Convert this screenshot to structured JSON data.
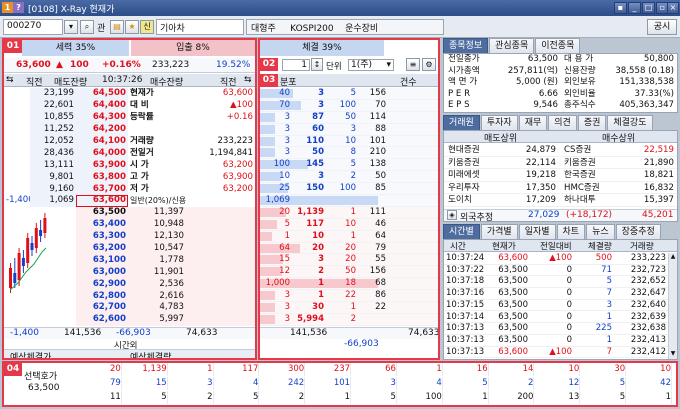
{
  "window": {
    "code": "0108",
    "title": "X-Ray 현재가"
  },
  "toolbar": {
    "stock_code": "000270",
    "search_label": "관",
    "favorite_icon": "star",
    "stock_badge": "신",
    "stock_name": "기아차",
    "tag1": "대형주",
    "tag2": "KOSPI200",
    "tag3": "운수장비",
    "public_button": "공시"
  },
  "section_badges": [
    "01",
    "02",
    "03",
    "04"
  ],
  "ratio": {
    "sell": "세력 35%",
    "buy": "입출 8%",
    "strength": "체결 39%"
  },
  "price_summary": {
    "price": "63,600",
    "diff": "100",
    "rate": "+0.16%",
    "volume": "233,223",
    "volrate": "19.52%"
  },
  "orderbook": {
    "headers": [
      "직전",
      "매도잔량",
      "10:37:26",
      "매수잔량",
      "직전"
    ],
    "asks": [
      [
        "",
        "23,199",
        "64,500"
      ],
      [
        "",
        "22,601",
        "64,400"
      ],
      [
        "",
        "10,855",
        "64,300"
      ],
      [
        "",
        "11,252",
        "64,200"
      ],
      [
        "",
        "12,052",
        "64,100"
      ],
      [
        "",
        "28,436",
        "64,000"
      ],
      [
        "",
        "13,111",
        "63,900"
      ],
      [
        "",
        "9,801",
        "63,800"
      ],
      [
        "",
        "9,160",
        "63,700"
      ],
      [
        "-1,400",
        "1,069",
        "63,600"
      ]
    ],
    "info": [
      [
        "현재가",
        "63,600"
      ],
      [
        "대 비",
        "▲100"
      ],
      [
        "등락률",
        "+0.16"
      ],
      [
        "",
        ""
      ],
      [
        "거래량",
        "233,223"
      ],
      [
        "전일거",
        "1,194,841"
      ],
      [
        "시 가",
        "63,200"
      ],
      [
        "고 가",
        "63,900"
      ],
      [
        "저 가",
        "63,200"
      ],
      [
        "일반(20%)/신용가능",
        ""
      ]
    ],
    "bids": [
      [
        "63,500",
        "11,397",
        ""
      ],
      [
        "63,400",
        "10,948",
        ""
      ],
      [
        "63,300",
        "12,130",
        ""
      ],
      [
        "63,200",
        "10,547",
        ""
      ],
      [
        "63,100",
        "1,778",
        ""
      ],
      [
        "63,000",
        "11,901",
        ""
      ],
      [
        "62,900",
        "2,536",
        ""
      ],
      [
        "62,800",
        "2,616",
        ""
      ],
      [
        "62,700",
        "4,783",
        ""
      ],
      [
        "62,600",
        "5,997",
        ""
      ]
    ],
    "total_left": "-1,400",
    "total_ask": "141,536",
    "total_diff": "-66,903",
    "total_bid": "74,633",
    "time_label": "시간외",
    "expect_label1": "예상체결가",
    "expect_label2": "예상체결량"
  },
  "section2": {
    "count": "1",
    "unit_label": "단위",
    "unit_value": "1(주)"
  },
  "distribution": {
    "headers": [
      "분포",
      "건수"
    ],
    "asks": [
      [
        "40",
        "3",
        "5",
        "156"
      ],
      [
        "70",
        "3",
        "100",
        "70"
      ],
      [
        "3",
        "87",
        "50",
        "114"
      ],
      [
        "3",
        "60",
        "3",
        "88"
      ],
      [
        "3",
        "110",
        "10",
        "101"
      ],
      [
        "3",
        "50",
        "8",
        "210"
      ],
      [
        "100",
        "145",
        "5",
        "138"
      ],
      [
        "10",
        "3",
        "2",
        "50"
      ],
      [
        "25",
        "150",
        "100",
        "85"
      ],
      [
        "1,069",
        "",
        "",
        ""
      ]
    ],
    "bids": [
      [
        "20",
        "1,139",
        "1",
        "111"
      ],
      [
        "5",
        "117",
        "10",
        "46"
      ],
      [
        "1",
        "10",
        "1",
        "64"
      ],
      [
        "64",
        "20",
        "20",
        "79"
      ],
      [
        "15",
        "3",
        "20",
        "55"
      ],
      [
        "12",
        "2",
        "50",
        "156"
      ],
      [
        "1,000",
        "1",
        "18",
        "68"
      ],
      [
        "3",
        "1",
        "22",
        "86"
      ],
      [
        "3",
        "30",
        "1",
        "22"
      ],
      [
        "3",
        "5,994",
        "2",
        ""
      ]
    ],
    "total_ask": "141,536",
    "total_bid": "74,633",
    "total_diff": "-66,903"
  },
  "info_tabs": [
    "종목정보",
    "관심종목",
    "이전종목"
  ],
  "stock_info": [
    [
      "전일종가",
      "63,500",
      "대 용 가",
      "50,800"
    ],
    [
      "시가총액",
      "257,811(억)",
      "신용잔량",
      "38,558 (0.18)"
    ],
    [
      "액 면 가",
      "5,000 (원)",
      "외인보유",
      "151,338,538"
    ],
    [
      "P E R",
      "6.66",
      "외인비율",
      "37.33(%)"
    ],
    [
      "E P S",
      "9,546",
      "총주식수",
      "405,363,347"
    ]
  ],
  "broker_tabs": [
    "거래원",
    "투자자",
    "재무",
    "의견",
    "증권",
    "체결강도"
  ],
  "broker_headers": [
    "매도상위",
    "매수상위"
  ],
  "brokers": [
    [
      "현대증권",
      "24,879",
      "CS증권",
      "22,519"
    ],
    [
      "키움증권",
      "22,114",
      "키움증권",
      "21,890"
    ],
    [
      "미래에셋",
      "19,218",
      "한국증권",
      "18,821"
    ],
    [
      "우리투자",
      "17,350",
      "HMC증권",
      "16,832"
    ],
    [
      "도이치",
      "17,209",
      "하나대투",
      "15,397"
    ]
  ],
  "foreign": {
    "label": "외국추정",
    "sell": "27,029",
    "diff": "(+18,172)",
    "buy": "45,201"
  },
  "trade_tabs": [
    "시간별",
    "가격별",
    "일자별",
    "차트",
    "뉴스",
    "장중추정"
  ],
  "trade_headers": [
    "시간",
    "현재가",
    "전일대비",
    "체결량",
    "거래량"
  ],
  "trades": [
    [
      "10:37:24",
      "63,600",
      "▲100",
      "500",
      "233,223"
    ],
    [
      "10:37:22",
      "63,500",
      "0",
      "71",
      "232,723"
    ],
    [
      "10:37:18",
      "63,500",
      "0",
      "5",
      "232,652"
    ],
    [
      "10:37:16",
      "63,500",
      "0",
      "7",
      "232,647"
    ],
    [
      "10:37:15",
      "63,500",
      "0",
      "3",
      "232,640"
    ],
    [
      "10:37:14",
      "63,500",
      "0",
      "1",
      "232,639"
    ],
    [
      "10:37:13",
      "63,500",
      "0",
      "225",
      "232,638"
    ],
    [
      "10:37:13",
      "63,500",
      "0",
      "1",
      "232,413"
    ],
    [
      "10:37:13",
      "63,600",
      "▲100",
      "7",
      "232,412"
    ]
  ],
  "selected_price": {
    "label": "선택호가",
    "value": "63,500"
  },
  "bottom_rows": [
    [
      "20",
      "1,139",
      "1",
      "117",
      "300",
      "237",
      "66",
      "1",
      "16",
      "14",
      "10",
      "30",
      "10"
    ],
    [
      "79",
      "15",
      "3",
      "4",
      "242",
      "101",
      "3",
      "4",
      "5",
      "2",
      "12",
      "5",
      "42"
    ],
    [
      "11",
      "5",
      "2",
      "5",
      "2",
      "1",
      "5",
      "100",
      "1",
      "200",
      "13",
      "5",
      "1"
    ]
  ],
  "colors": {
    "accent": "#e53848",
    "tab": "#4e6c9e",
    "up": "#e0101a",
    "down": "#1340c8"
  }
}
